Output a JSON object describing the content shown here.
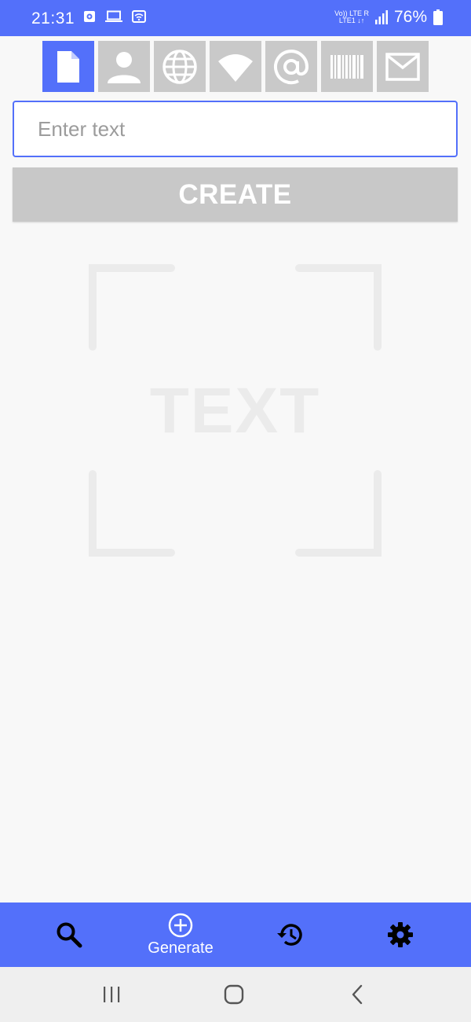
{
  "status_bar": {
    "time": "21:31",
    "network_top": "Vo))  LTE R",
    "network_bottom": "LTE1  ↓↑",
    "battery": "76%",
    "left_icons": [
      "media-icon",
      "laptop-icon",
      "wifi-box-icon"
    ]
  },
  "type_selector": {
    "items": [
      {
        "icon": "text-file-icon",
        "active": true
      },
      {
        "icon": "contact-icon",
        "active": false
      },
      {
        "icon": "globe-icon",
        "active": false
      },
      {
        "icon": "wifi-icon",
        "active": false
      },
      {
        "icon": "at-icon",
        "active": false
      },
      {
        "icon": "barcode-icon",
        "active": false
      },
      {
        "icon": "mail-icon",
        "active": false
      }
    ]
  },
  "input": {
    "placeholder": "Enter text",
    "value": ""
  },
  "create_button": {
    "label": "CREATE"
  },
  "preview": {
    "label": "TEXT"
  },
  "bottom_nav": {
    "items": [
      {
        "icon": "search-icon",
        "label": ""
      },
      {
        "icon": "add-circle-icon",
        "label": "Generate"
      },
      {
        "icon": "history-icon",
        "label": ""
      },
      {
        "icon": "gear-icon",
        "label": ""
      }
    ]
  },
  "colors": {
    "accent": "#5370fa",
    "inactive_tile": "#c9c9c9",
    "button_disabled": "#c8c8c8",
    "placeholder_mark": "#ebebeb"
  },
  "system_nav": [
    "recents-icon",
    "home-icon",
    "back-icon"
  ]
}
